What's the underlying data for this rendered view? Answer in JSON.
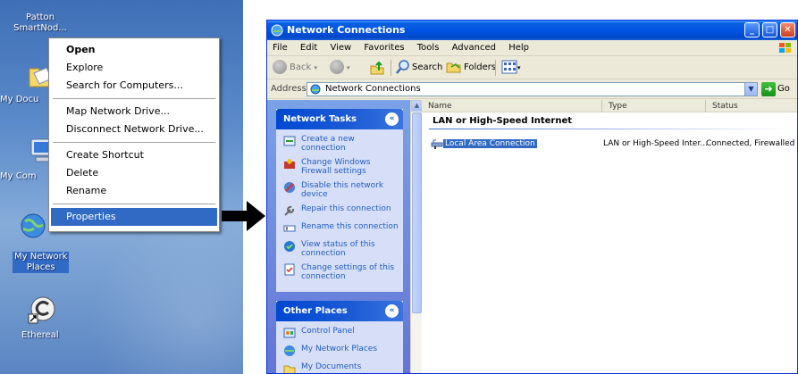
{
  "desktop": {
    "icons": [
      {
        "label_line1": "Patton",
        "label_line2": "SmartNod..."
      },
      {
        "label_line1": "My Docu",
        "label_line2": ""
      },
      {
        "label_line1": "My Com",
        "label_line2": ""
      },
      {
        "label_line1": "My Network",
        "label_line2": "Places"
      },
      {
        "label_line1": "Ethereal",
        "label_line2": ""
      }
    ]
  },
  "context_menu": {
    "items": [
      {
        "label": "Open"
      },
      {
        "label": "Explore"
      },
      {
        "label": "Search for Computers..."
      },
      {
        "label": "Map Network Drive..."
      },
      {
        "label": "Disconnect Network Drive..."
      },
      {
        "label": "Create Shortcut"
      },
      {
        "label": "Delete"
      },
      {
        "label": "Rename"
      },
      {
        "label": "Properties"
      }
    ]
  },
  "window": {
    "title": "Network Connections",
    "menu": {
      "file": "File",
      "edit": "Edit",
      "view": "View",
      "favorites": "Favorites",
      "tools": "Tools",
      "advanced": "Advanced",
      "help": "Help"
    },
    "toolbar": {
      "back": "Back",
      "search": "Search",
      "folders": "Folders"
    },
    "address": {
      "label": "Address",
      "value": "Network Connections",
      "go": "Go"
    },
    "task_pane": {
      "network_tasks_title": "Network Tasks",
      "network_tasks": [
        "Create a new connection",
        "Change Windows Firewall settings",
        "Disable this network device",
        "Repair this connection",
        "Rename this connection",
        "View status of this connection",
        "Change settings of this connection"
      ],
      "other_places_title": "Other Places",
      "other_places": [
        "Control Panel",
        "My Network Places",
        "My Documents"
      ]
    },
    "list": {
      "columns": {
        "name": "Name",
        "type": "Type",
        "status": "Status"
      },
      "group": "LAN or High-Speed Internet",
      "rows": [
        {
          "name": "Local Area Connection",
          "type": "LAN or High-Speed Inter...",
          "status": "Connected, Firewalled"
        }
      ]
    }
  }
}
